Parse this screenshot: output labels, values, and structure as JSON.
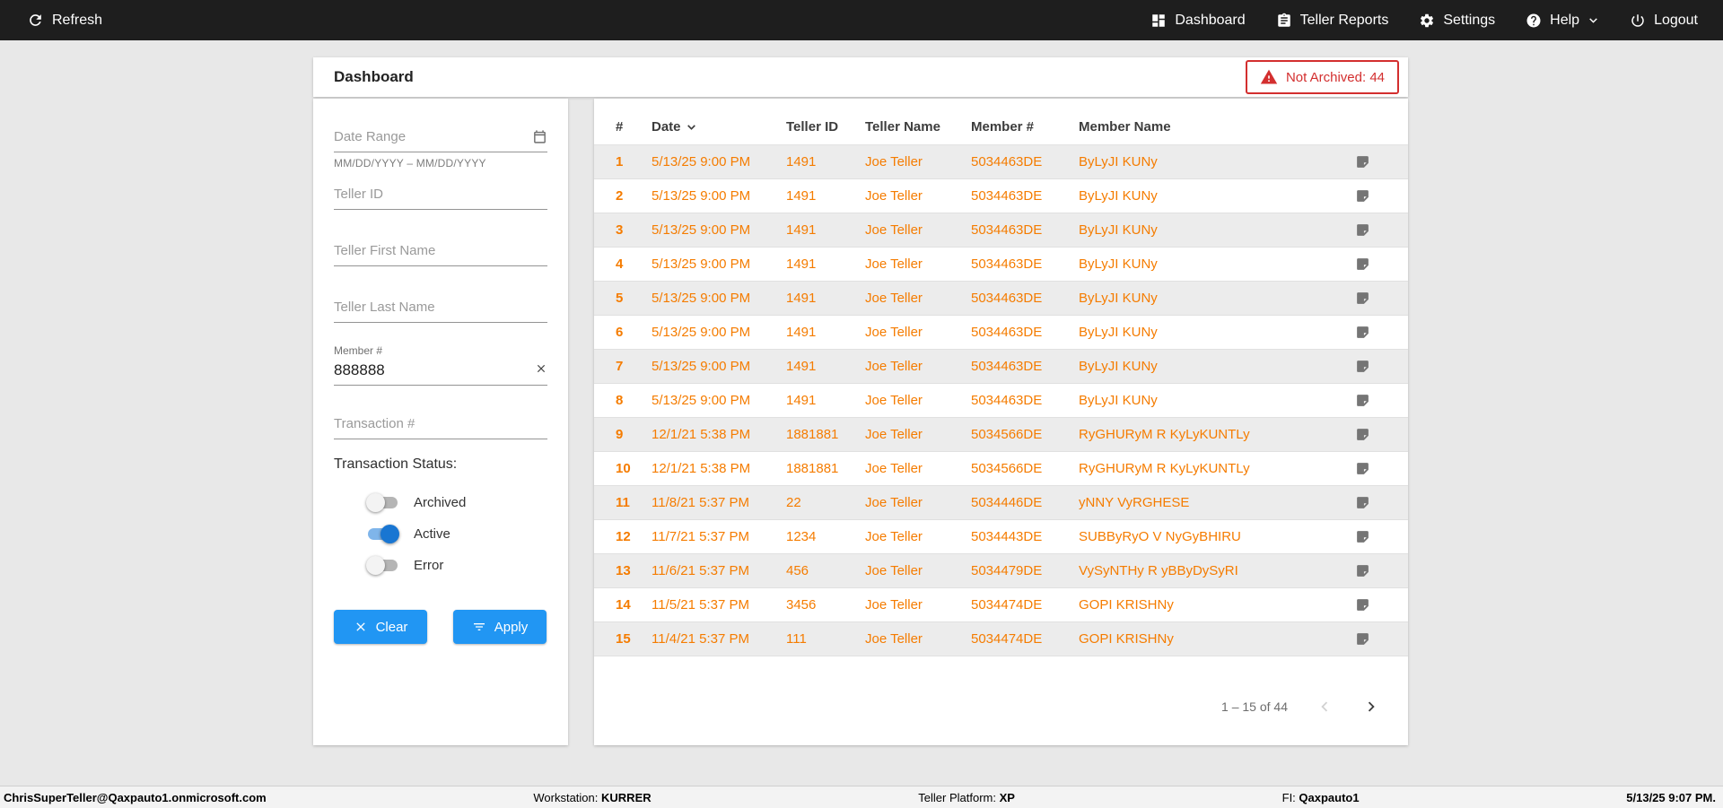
{
  "topbar": {
    "refresh_label": "Refresh",
    "nav": [
      {
        "label": "Dashboard",
        "icon": "dashboard-icon"
      },
      {
        "label": "Teller Reports",
        "icon": "reports-icon"
      },
      {
        "label": "Settings",
        "icon": "gear-icon"
      },
      {
        "label": "Help",
        "icon": "help-icon"
      },
      {
        "label": "Logout",
        "icon": "power-icon"
      }
    ]
  },
  "header": {
    "title": "Dashboard",
    "alert_label": "Not Archived: 44"
  },
  "filters": {
    "date_range_placeholder": "Date Range",
    "date_range_helper": "MM/DD/YYYY – MM/DD/YYYY",
    "teller_id_placeholder": "Teller ID",
    "teller_first_name_placeholder": "Teller First Name",
    "teller_last_name_placeholder": "Teller Last Name",
    "member_label": "Member #",
    "member_value": "888888",
    "transaction_placeholder": "Transaction #",
    "status_label": "Transaction Status:",
    "toggles": [
      {
        "label": "Archived",
        "on": false
      },
      {
        "label": "Active",
        "on": true
      },
      {
        "label": "Error",
        "on": false
      }
    ],
    "clear_label": "Clear",
    "apply_label": "Apply"
  },
  "table": {
    "columns": [
      "#",
      "Date",
      "Teller ID",
      "Teller Name",
      "Member #",
      "Member Name"
    ],
    "rows": [
      {
        "num": "1",
        "date": "5/13/25 9:00 PM",
        "teller_id": "1491",
        "teller_name": "Joe Teller",
        "member_num": "5034463DE",
        "member_name": "ByLyJI KUNy"
      },
      {
        "num": "2",
        "date": "5/13/25 9:00 PM",
        "teller_id": "1491",
        "teller_name": "Joe Teller",
        "member_num": "5034463DE",
        "member_name": "ByLyJI KUNy"
      },
      {
        "num": "3",
        "date": "5/13/25 9:00 PM",
        "teller_id": "1491",
        "teller_name": "Joe Teller",
        "member_num": "5034463DE",
        "member_name": "ByLyJI KUNy"
      },
      {
        "num": "4",
        "date": "5/13/25 9:00 PM",
        "teller_id": "1491",
        "teller_name": "Joe Teller",
        "member_num": "5034463DE",
        "member_name": "ByLyJI KUNy"
      },
      {
        "num": "5",
        "date": "5/13/25 9:00 PM",
        "teller_id": "1491",
        "teller_name": "Joe Teller",
        "member_num": "5034463DE",
        "member_name": "ByLyJI KUNy"
      },
      {
        "num": "6",
        "date": "5/13/25 9:00 PM",
        "teller_id": "1491",
        "teller_name": "Joe Teller",
        "member_num": "5034463DE",
        "member_name": "ByLyJI KUNy"
      },
      {
        "num": "7",
        "date": "5/13/25 9:00 PM",
        "teller_id": "1491",
        "teller_name": "Joe Teller",
        "member_num": "5034463DE",
        "member_name": "ByLyJI KUNy"
      },
      {
        "num": "8",
        "date": "5/13/25 9:00 PM",
        "teller_id": "1491",
        "teller_name": "Joe Teller",
        "member_num": "5034463DE",
        "member_name": "ByLyJI KUNy"
      },
      {
        "num": "9",
        "date": "12/1/21 5:38 PM",
        "teller_id": "1881881",
        "teller_name": "Joe Teller",
        "member_num": "5034566DE",
        "member_name": "RyGHURyM R KyLyKUNTLy"
      },
      {
        "num": "10",
        "date": "12/1/21 5:38 PM",
        "teller_id": "1881881",
        "teller_name": "Joe Teller",
        "member_num": "5034566DE",
        "member_name": "RyGHURyM R KyLyKUNTLy"
      },
      {
        "num": "11",
        "date": "11/8/21 5:37 PM",
        "teller_id": "22",
        "teller_name": "Joe Teller",
        "member_num": "5034446DE",
        "member_name": "yNNY VyRGHESE"
      },
      {
        "num": "12",
        "date": "11/7/21 5:37 PM",
        "teller_id": "1234",
        "teller_name": "Joe Teller",
        "member_num": "5034443DE",
        "member_name": "SUBByRyO V NyGyBHIRU"
      },
      {
        "num": "13",
        "date": "11/6/21 5:37 PM",
        "teller_id": "456",
        "teller_name": "Joe Teller",
        "member_num": "5034479DE",
        "member_name": "VySyNTHy R yBByDySyRI"
      },
      {
        "num": "14",
        "date": "11/5/21 5:37 PM",
        "teller_id": "3456",
        "teller_name": "Joe Teller",
        "member_num": "5034474DE",
        "member_name": "GOPI KRISHNy"
      },
      {
        "num": "15",
        "date": "11/4/21 5:37 PM",
        "teller_id": "111",
        "teller_name": "Joe Teller",
        "member_num": "5034474DE",
        "member_name": "GOPI KRISHNy"
      }
    ],
    "pagination": {
      "range": "1 – 15 of 44"
    }
  },
  "footer": {
    "user": "ChrisSuperTeller@Qaxpauto1.onmicrosoft.com",
    "workstation_label": "Workstation:",
    "workstation_value": "KURRER",
    "platform_label": "Teller Platform:",
    "platform_value": "XP",
    "fi_label": "FI:",
    "fi_value": "Qaxpauto1",
    "datetime": "5/13/25 9:07 PM."
  },
  "colors": {
    "accent_blue": "#2196f3",
    "row_orange": "#f57c00",
    "alert_red": "#d32f2f",
    "topbar_bg": "#1e1e1e"
  }
}
